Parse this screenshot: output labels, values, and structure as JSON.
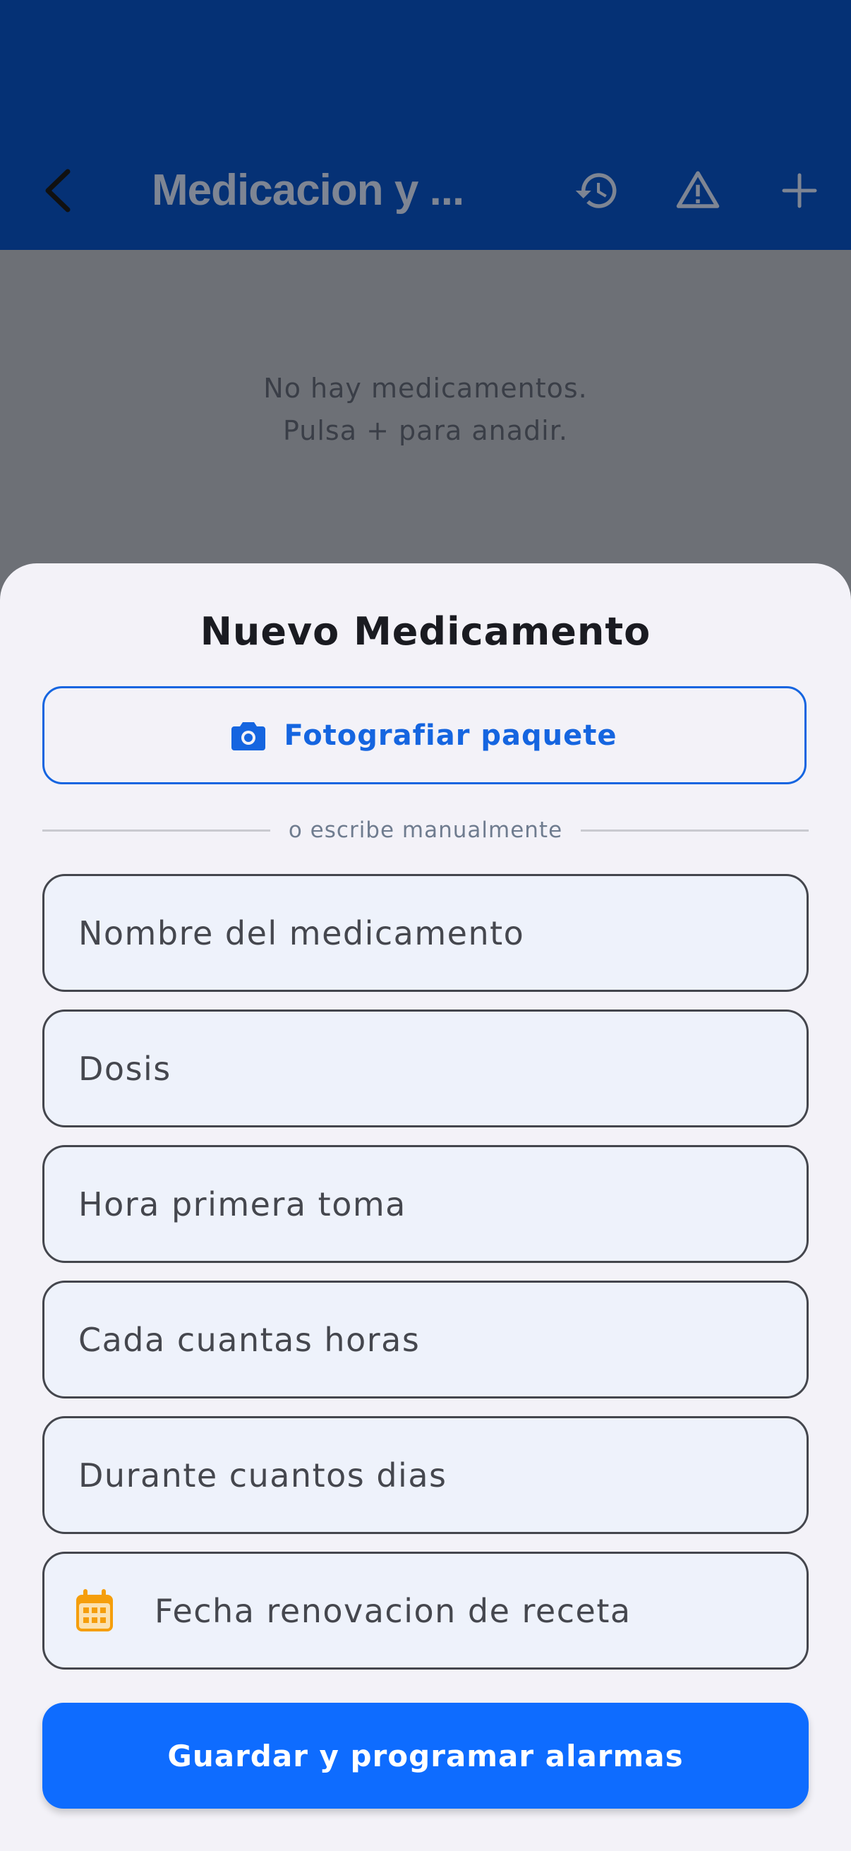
{
  "appbar": {
    "title": "Medicacion y ...",
    "icons": [
      "back-arrow-icon",
      "history-icon",
      "warning-icon",
      "plus-icon"
    ]
  },
  "empty_state": {
    "line1": "No hay medicamentos.",
    "line2": "Pulsa + para anadir."
  },
  "sheet": {
    "title": "Nuevo Medicamento",
    "photo_button_label": "Fotografiar paquete",
    "divider_text": "o escribe manualmente",
    "fields": {
      "name": {
        "placeholder": "Nombre del medicamento"
      },
      "dose": {
        "placeholder": "Dosis"
      },
      "first_time": {
        "placeholder": "Hora primera toma"
      },
      "interval": {
        "placeholder": "Cada cuantas horas"
      },
      "duration": {
        "placeholder": "Durante cuantos dias"
      },
      "renewal": {
        "placeholder": "Fecha renovacion de receta"
      }
    },
    "save_button_label": "Guardar y programar alarmas"
  },
  "colors": {
    "appbar": "#053175",
    "primary": "#0e6cff",
    "outline_primary": "#1565e0",
    "calendar_icon": "#f59e0b",
    "sheet_bg": "#f3f2f8",
    "field_bg": "#eef2fb"
  }
}
